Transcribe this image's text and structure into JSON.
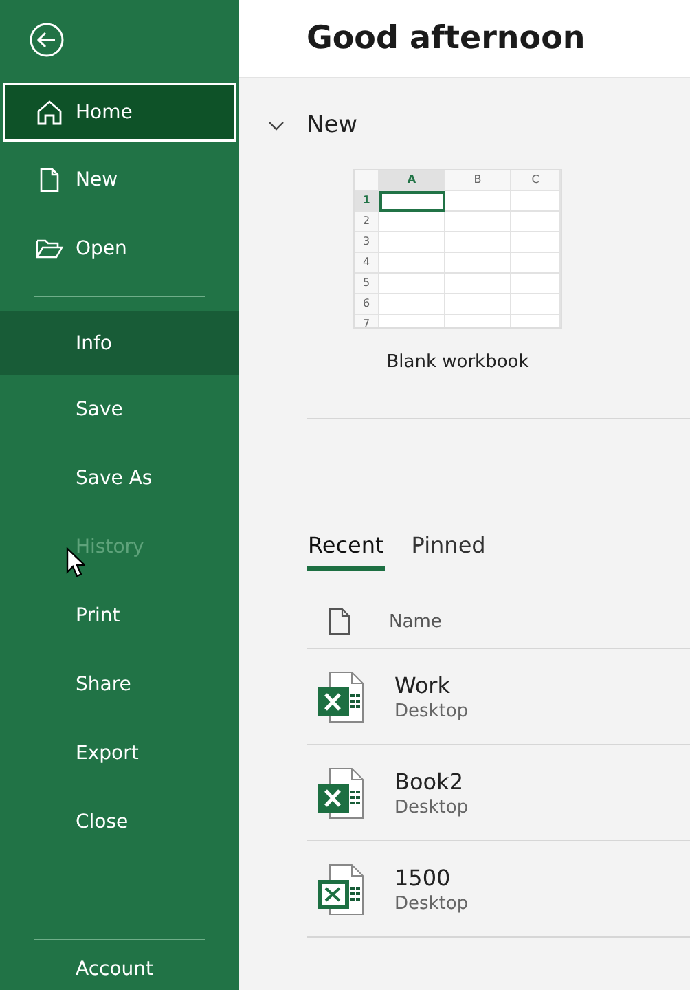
{
  "sidebar": {
    "items": [
      {
        "label": "Home",
        "kind": "home",
        "selected": true,
        "highlighted": false,
        "disabled": false
      },
      {
        "label": "New",
        "kind": "new",
        "selected": false,
        "highlighted": false,
        "disabled": false
      },
      {
        "label": "Open",
        "kind": "open",
        "selected": false,
        "highlighted": false,
        "disabled": false
      },
      {
        "label": "Info",
        "kind": "plain",
        "selected": false,
        "highlighted": true,
        "disabled": false
      },
      {
        "label": "Save",
        "kind": "plain",
        "selected": false,
        "highlighted": false,
        "disabled": false
      },
      {
        "label": "Save As",
        "kind": "plain",
        "selected": false,
        "highlighted": false,
        "disabled": false
      },
      {
        "label": "History",
        "kind": "plain",
        "selected": false,
        "highlighted": false,
        "disabled": true
      },
      {
        "label": "Print",
        "kind": "plain",
        "selected": false,
        "highlighted": false,
        "disabled": false
      },
      {
        "label": "Share",
        "kind": "plain",
        "selected": false,
        "highlighted": false,
        "disabled": false
      },
      {
        "label": "Export",
        "kind": "plain",
        "selected": false,
        "highlighted": false,
        "disabled": false
      },
      {
        "label": "Close",
        "kind": "plain",
        "selected": false,
        "highlighted": false,
        "disabled": false
      }
    ],
    "footer_item": "Account"
  },
  "greeting": "Good afternoon",
  "new_section": {
    "title": "New",
    "expanded": true,
    "template": {
      "label": "Blank workbook",
      "columns": [
        "A",
        "B",
        "C"
      ],
      "rows": [
        "1",
        "2",
        "3",
        "4",
        "5",
        "6",
        "7"
      ]
    }
  },
  "tabs": [
    {
      "label": "Recent",
      "selected": true
    },
    {
      "label": "Pinned",
      "selected": false
    }
  ],
  "files": {
    "column": "Name",
    "rows": [
      {
        "name": "Work",
        "location": "Desktop",
        "kind": "xlsx"
      },
      {
        "name": "Book2",
        "location": "Desktop",
        "kind": "xlsx"
      },
      {
        "name": "1500",
        "location": "Desktop",
        "kind": "csv"
      }
    ]
  }
}
